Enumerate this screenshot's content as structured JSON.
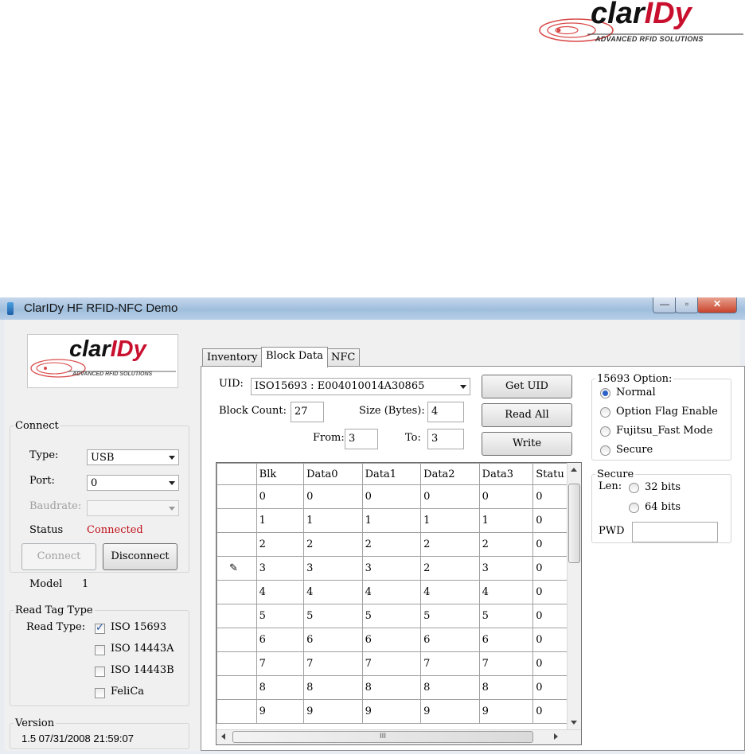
{
  "logo": {
    "brand_prefix": "clar",
    "brand_suffix": "IDy",
    "tagline": "ADVANCED RFID SOLUTIONS"
  },
  "window": {
    "title": "ClarIDy HF RFID-NFC Demo"
  },
  "connect": {
    "legend": "Connect",
    "type_label": "Type:",
    "type_value": "USB",
    "port_label": "Port:",
    "port_value": "0",
    "baudrate_label": "Baudrate:",
    "baudrate_value": "",
    "status_label": "Status",
    "status_value": "Connected",
    "connect_button": "Connect",
    "disconnect_button": "Disconnect",
    "model_label": "Model",
    "model_value": "1"
  },
  "read_tag_type": {
    "legend": "Read Tag Type",
    "read_type_label": "Read Type:",
    "options": [
      {
        "label": "ISO 15693",
        "checked": true
      },
      {
        "label": "ISO 14443A",
        "checked": false
      },
      {
        "label": "ISO 14443B",
        "checked": false
      },
      {
        "label": "FeliCa",
        "checked": false
      }
    ]
  },
  "version": {
    "legend": "Version",
    "value": "1.5 07/31/2008 21:59:07"
  },
  "tabs": [
    {
      "label": "Inventory"
    },
    {
      "label": "Block Data"
    },
    {
      "label": "NFC"
    }
  ],
  "block_data": {
    "uid_label": "UID:",
    "uid_value": "ISO15693 : E004010014A30865",
    "block_count_label": "Block Count:",
    "block_count_value": "27",
    "size_label": "Size (Bytes):",
    "size_value": "4",
    "from_label": "From:",
    "from_value": "3",
    "to_label": "To:",
    "to_value": "3",
    "get_uid_button": "Get UID",
    "read_all_button": "Read All",
    "write_button": "Write",
    "edit_row_icon": "pencil-icon",
    "grid": {
      "columns": [
        "Blk",
        "Data0",
        "Data1",
        "Data2",
        "Data3",
        "Statu"
      ],
      "rows": [
        [
          "0",
          "0",
          "0",
          "0",
          "0",
          "0"
        ],
        [
          "1",
          "1",
          "1",
          "1",
          "1",
          "0"
        ],
        [
          "2",
          "2",
          "2",
          "2",
          "2",
          "0"
        ],
        [
          "3",
          "3",
          "3",
          "2",
          "3",
          "0"
        ],
        [
          "4",
          "4",
          "4",
          "4",
          "4",
          "0"
        ],
        [
          "5",
          "5",
          "5",
          "5",
          "5",
          "0"
        ],
        [
          "6",
          "6",
          "6",
          "6",
          "6",
          "0"
        ],
        [
          "7",
          "7",
          "7",
          "7",
          "7",
          "0"
        ],
        [
          "8",
          "8",
          "8",
          "8",
          "8",
          "0"
        ],
        [
          "9",
          "9",
          "9",
          "9",
          "9",
          "0"
        ]
      ],
      "hscroll_grip": "III"
    }
  },
  "option_15693": {
    "legend": "15693 Option:",
    "options": [
      {
        "label": "Normal",
        "selected": true
      },
      {
        "label": "Option Flag Enable",
        "selected": false
      },
      {
        "label": "Fujitsu_Fast Mode",
        "selected": false
      },
      {
        "label": "Secure",
        "selected": false
      }
    ]
  },
  "secure": {
    "legend": "Secure",
    "len_label": "Len:",
    "len_options": [
      {
        "label": "32 bits",
        "selected": false
      },
      {
        "label": "64 bits",
        "selected": false
      }
    ],
    "pwd_label": "PWD",
    "pwd_value": ""
  },
  "colors": {
    "status_connected": "#c0101a",
    "brand_red": "#c8102e",
    "titlebar": "#a8c4e2"
  }
}
